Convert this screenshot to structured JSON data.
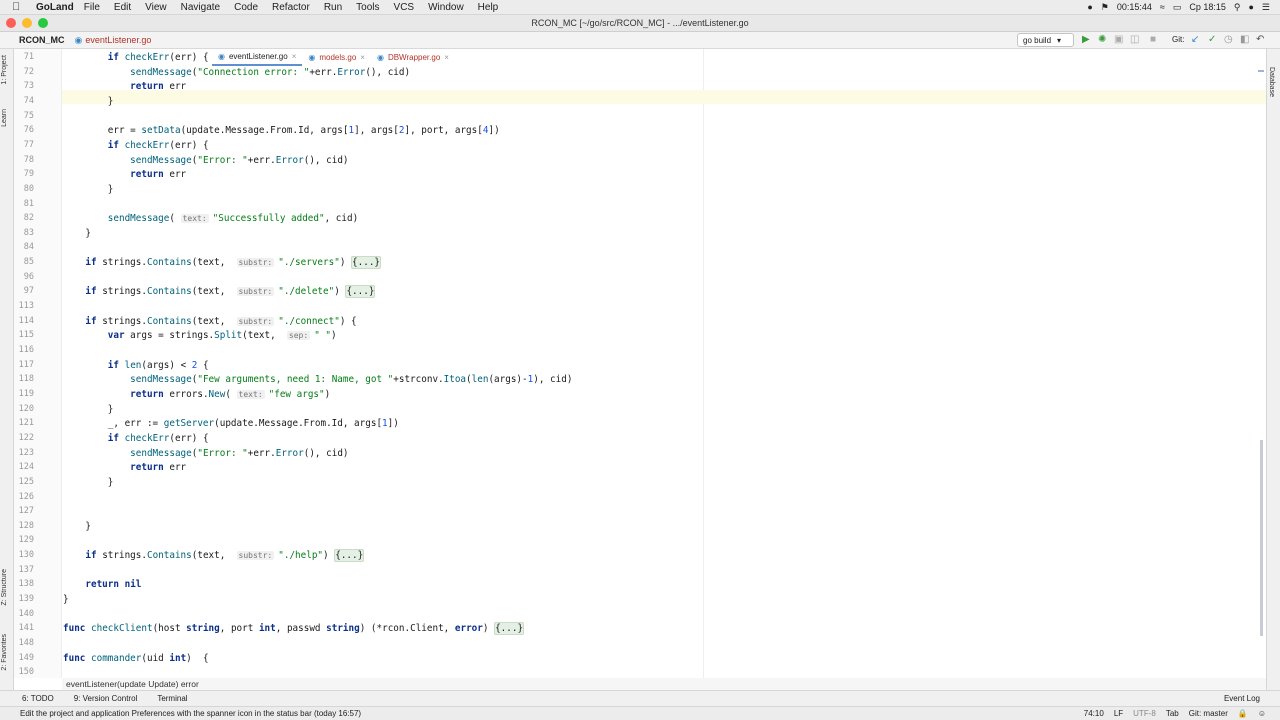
{
  "menubar": {
    "app_name": "GoLand",
    "items": [
      "File",
      "Edit",
      "View",
      "Navigate",
      "Code",
      "Refactor",
      "Run",
      "Tools",
      "VCS",
      "Window",
      "Help"
    ],
    "timer": "00:15:44",
    "clock": "Ср 18:15"
  },
  "window": {
    "title": "RCON_MC [~/go/src/RCON_MC] - .../eventListener.go"
  },
  "navbar": {
    "project": "RCON_MC",
    "file": "eventListener.go",
    "run_config": "go build",
    "git_label": "Git:"
  },
  "tabs": [
    {
      "label": "eventListener.go",
      "active": true
    },
    {
      "label": "models.go",
      "active": false
    },
    {
      "label": "DBWrapper.go",
      "active": false
    }
  ],
  "side_tabs_left": [
    "1: Project",
    "Learn",
    "Z: Structure",
    "2: Favorites"
  ],
  "side_tabs_right": [
    "Database"
  ],
  "lines": [
    {
      "n": "71",
      "code": "        if checkErr(err) {"
    },
    {
      "n": "72",
      "code": "            sendMessage(\"Connection error: \"+err.Error(), cid)"
    },
    {
      "n": "73",
      "code": "            return err"
    },
    {
      "n": "74",
      "code": "        }"
    },
    {
      "n": "75",
      "code": ""
    },
    {
      "n": "76",
      "code": "        err = setData(update.Message.From.Id, args[1], args[2], port, args[4])"
    },
    {
      "n": "77",
      "code": "        if checkErr(err) {"
    },
    {
      "n": "78",
      "code": "            sendMessage(\"Error: \"+err.Error(), cid)"
    },
    {
      "n": "79",
      "code": "            return err"
    },
    {
      "n": "80",
      "code": "        }"
    },
    {
      "n": "81",
      "code": ""
    },
    {
      "n": "82",
      "code": "        sendMessage( text: \"Successfully added\", cid)"
    },
    {
      "n": "83",
      "code": "    }"
    },
    {
      "n": "84",
      "code": ""
    },
    {
      "n": "85",
      "code": "    if strings.Contains(text,  substr: \"./servers\") {...}"
    },
    {
      "n": "96",
      "code": ""
    },
    {
      "n": "97",
      "code": "    if strings.Contains(text,  substr: \"./delete\") {...}"
    },
    {
      "n": "113",
      "code": ""
    },
    {
      "n": "114",
      "code": "    if strings.Contains(text,  substr: \"./connect\") {"
    },
    {
      "n": "115",
      "code": "        var args = strings.Split(text,  sep: \" \")"
    },
    {
      "n": "116",
      "code": ""
    },
    {
      "n": "117",
      "code": "        if len(args) < 2 {"
    },
    {
      "n": "118",
      "code": "            sendMessage(\"Few arguments, need 1: Name, got \"+strconv.Itoa(len(args)-1), cid)"
    },
    {
      "n": "119",
      "code": "            return errors.New( text: \"few args\")"
    },
    {
      "n": "120",
      "code": "        }"
    },
    {
      "n": "121",
      "code": "        _, err := getServer(update.Message.From.Id, args[1])"
    },
    {
      "n": "122",
      "code": "        if checkErr(err) {"
    },
    {
      "n": "123",
      "code": "            sendMessage(\"Error: \"+err.Error(), cid)"
    },
    {
      "n": "124",
      "code": "            return err"
    },
    {
      "n": "125",
      "code": "        }"
    },
    {
      "n": "126",
      "code": ""
    },
    {
      "n": "127",
      "code": ""
    },
    {
      "n": "128",
      "code": "    }"
    },
    {
      "n": "129",
      "code": ""
    },
    {
      "n": "130",
      "code": "    if strings.Contains(text,  substr: \"./help\") {...}"
    },
    {
      "n": "137",
      "code": ""
    },
    {
      "n": "138",
      "code": "    return nil"
    },
    {
      "n": "139",
      "code": "}"
    },
    {
      "n": "140",
      "code": ""
    },
    {
      "n": "141",
      "code": "func checkClient(host string, port int, passwd string) (*rcon.Client, error) {...}"
    },
    {
      "n": "148",
      "code": ""
    },
    {
      "n": "149",
      "code": "func commander(uid int)  {"
    },
    {
      "n": "150",
      "code": ""
    }
  ],
  "breadcrumb": "eventListener(update Update) error",
  "toolwindows": [
    "6: TODO",
    "9: Version Control",
    "Terminal"
  ],
  "event_log": "Event Log",
  "status": {
    "message": "Edit the project and application Preferences with the spanner icon in the status bar (today 16:57)",
    "position": "74:10",
    "line_sep": "LF",
    "encoding": "UTF-8",
    "indent": "Tab",
    "git": "Git: master"
  }
}
